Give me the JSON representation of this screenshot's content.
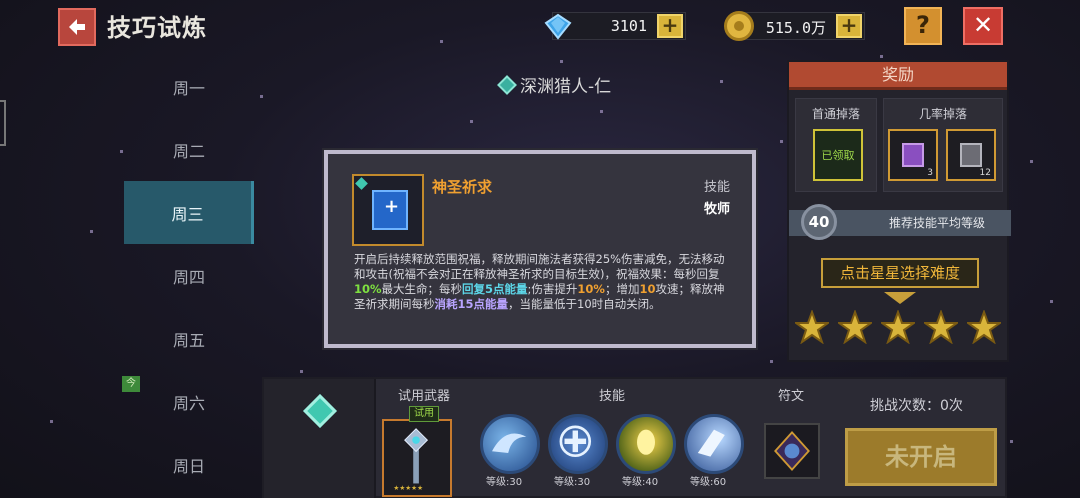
{
  "header": {
    "title": "技巧试炼",
    "gems": "3101",
    "coins": "515.0万"
  },
  "days": {
    "items": [
      {
        "label": "周一"
      },
      {
        "label": "周二"
      },
      {
        "label": "周三",
        "active": true
      },
      {
        "label": "周四"
      },
      {
        "label": "周五"
      },
      {
        "label": "周六",
        "badge": "今"
      },
      {
        "label": "周日"
      }
    ]
  },
  "stage": {
    "name": "深渊猎人-仁"
  },
  "reward": {
    "title": "奖励",
    "normal_drop_label": "首通掉落",
    "normal_drop_status": "已领取",
    "chance_drop_label": "几率掉落",
    "chance_items": [
      {
        "count": "3",
        "color": "#8a4fc0"
      },
      {
        "count": "12",
        "color": "#6c6c74"
      }
    ],
    "recommended_level": "40",
    "recommended_label": "推荐技能平均等级",
    "difficulty_button": "点击星星选择难度",
    "stars": 5
  },
  "popup": {
    "skill_name": "神圣祈求",
    "type_label": "技能",
    "class_label": "牧师",
    "desc_parts": [
      {
        "text": "开启后持续释放范围祝福，释放期间施法者获得25%伤害减免，无法移动和攻击(祝福不会对正在释放神圣祈求的目标生效)，祝福效果：每秒回复",
        "style": ""
      },
      {
        "text": "10%",
        "style": "hl-green"
      },
      {
        "text": "最大生命；每秒",
        "style": ""
      },
      {
        "text": "回复5点能量",
        "style": "hl-cyan"
      },
      {
        "text": ";伤害提升",
        "style": ""
      },
      {
        "text": "10%",
        "style": "hl-orange"
      },
      {
        "text": "；增加",
        "style": ""
      },
      {
        "text": "10",
        "style": "hl-orange"
      },
      {
        "text": "攻速；释放神圣祈求期间每秒",
        "style": ""
      },
      {
        "text": "消耗15点能量",
        "style": "hl-purple"
      },
      {
        "text": "，当能量低于10时自动关闭。",
        "style": ""
      }
    ]
  },
  "bottom": {
    "weapon_label": "试用武器",
    "trial_badge": "试用",
    "skills_label": "技能",
    "rune_label": "符文",
    "skills": [
      {
        "level": "等级:30"
      },
      {
        "level": "等级:30"
      },
      {
        "level": "等级:40"
      },
      {
        "level": "等级:60"
      }
    ],
    "challenge_count": "挑战次数：0次",
    "start_button": "未开启"
  },
  "colors": {
    "accent": "#27596a",
    "reward_header": "#b14a31",
    "gold": "#d9b43a",
    "star": "#d9b43a"
  }
}
